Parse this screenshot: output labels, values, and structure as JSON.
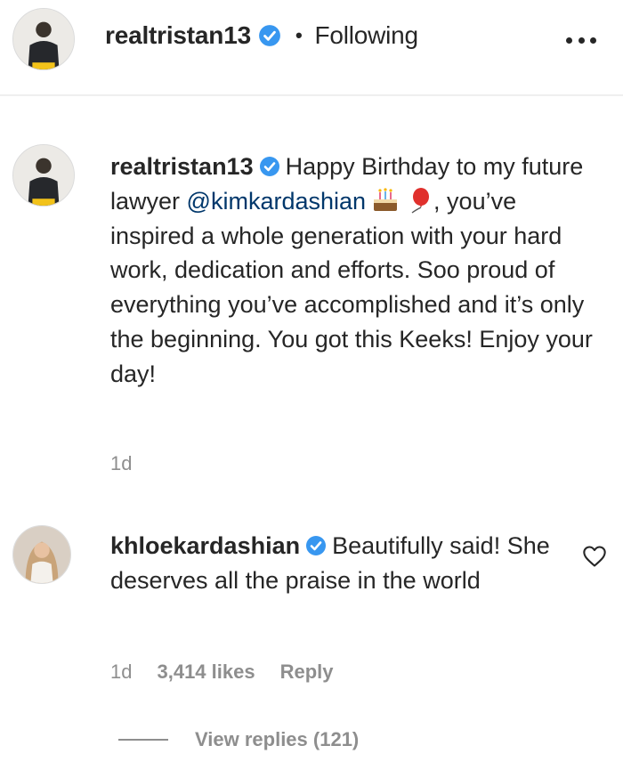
{
  "header": {
    "username": "realtristan13",
    "separator": "•",
    "follow_status": "Following",
    "avatar_icon": "user-avatar",
    "more_icon": "more-options-icon"
  },
  "post": {
    "username": "realtristan13",
    "caption_part1": "Happy Birthday to my future lawyer",
    "mention": "@kimkardashian",
    "emojis": [
      "birthday-cake-emoji",
      "balloon-emoji"
    ],
    "caption_part2": ", you’ve inspired a whole generation with your hard work, dedication and efforts. Soo proud of everything you’ve accomplished and it’s only the beginning. You got this Keeks! Enjoy your day!",
    "time": "1d"
  },
  "comment": {
    "username": "khloekardashian",
    "text": "Beautifully said! She deserves all the praise in the world",
    "time": "1d",
    "likes": "3,414 likes",
    "reply_label": "Reply",
    "like_icon": "heart-icon"
  },
  "replies": {
    "label": "View replies (121)"
  },
  "colors": {
    "text": "#262626",
    "secondary": "#8e8e8e",
    "mention": "#00376b",
    "verified": "#3897f0"
  }
}
